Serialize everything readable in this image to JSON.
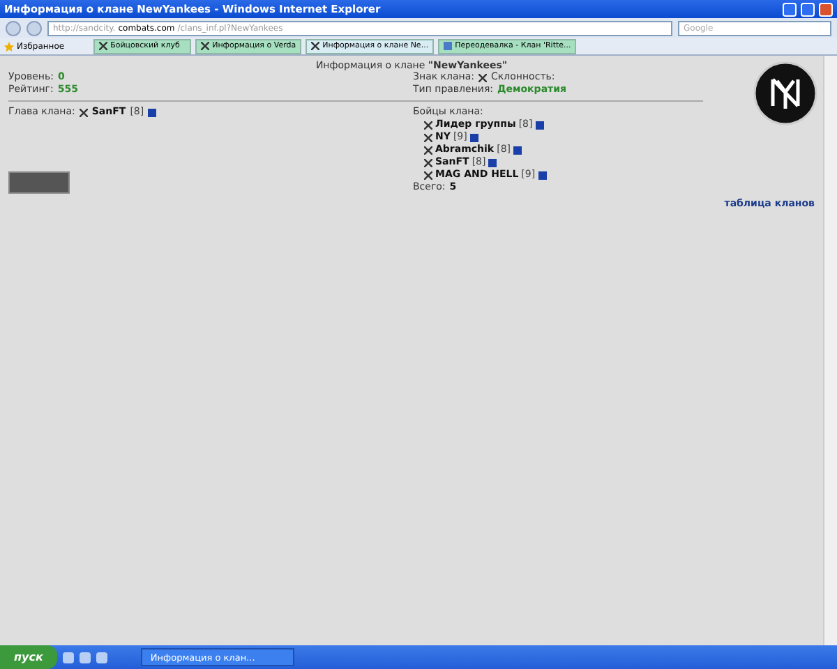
{
  "window": {
    "title": "Информация о клане NewYankees - Windows Internet Explorer"
  },
  "address_bar": {
    "url_prefix": "http://sandcity.",
    "url_domain": "combats.com",
    "url_path": "/clans_inf.pl?NewYankees",
    "search_placeholder": "Google"
  },
  "favorites": {
    "label": "Избранное"
  },
  "tabs": [
    {
      "label": "Бойцовский клуб",
      "selected": false,
      "kind": "page"
    },
    {
      "label": "Информация о Verda",
      "selected": false,
      "kind": "page"
    },
    {
      "label": "Информация о клане Ne...",
      "selected": true,
      "kind": "page"
    },
    {
      "label": "Переодевалка - Клан 'Ritte...",
      "selected": false,
      "kind": "doc"
    }
  ],
  "page": {
    "heading_prefix": "Информация о клане",
    "clan_name": "\"NewYankees\"",
    "stats": [
      {
        "label": "Уровень:",
        "value": "0"
      },
      {
        "label": "Рейтинг:",
        "value": "555"
      }
    ],
    "sign_label": "Знак клана:",
    "alignment_label": "Склонность:",
    "government_label": "Тип правления:",
    "government_value": "Демократия",
    "leader_label": "Глава клана:",
    "leader": {
      "name": "SanFT",
      "level": "[8]"
    },
    "members_label": "Бойцы клана:",
    "members": [
      {
        "name": "Лидер группы",
        "level": "[8]"
      },
      {
        "name": "NY",
        "level": "[9]"
      },
      {
        "name": "Abramchik",
        "level": "[8]"
      },
      {
        "name": "SanFT",
        "level": "[8]"
      },
      {
        "name": "MAG AND HELL",
        "level": "[9]"
      }
    ],
    "total_label": "Всего:",
    "total_value": "5",
    "clans_link": "таблица кланов"
  },
  "taskbar": {
    "start": "пуск",
    "window": "Информация о клан..."
  }
}
